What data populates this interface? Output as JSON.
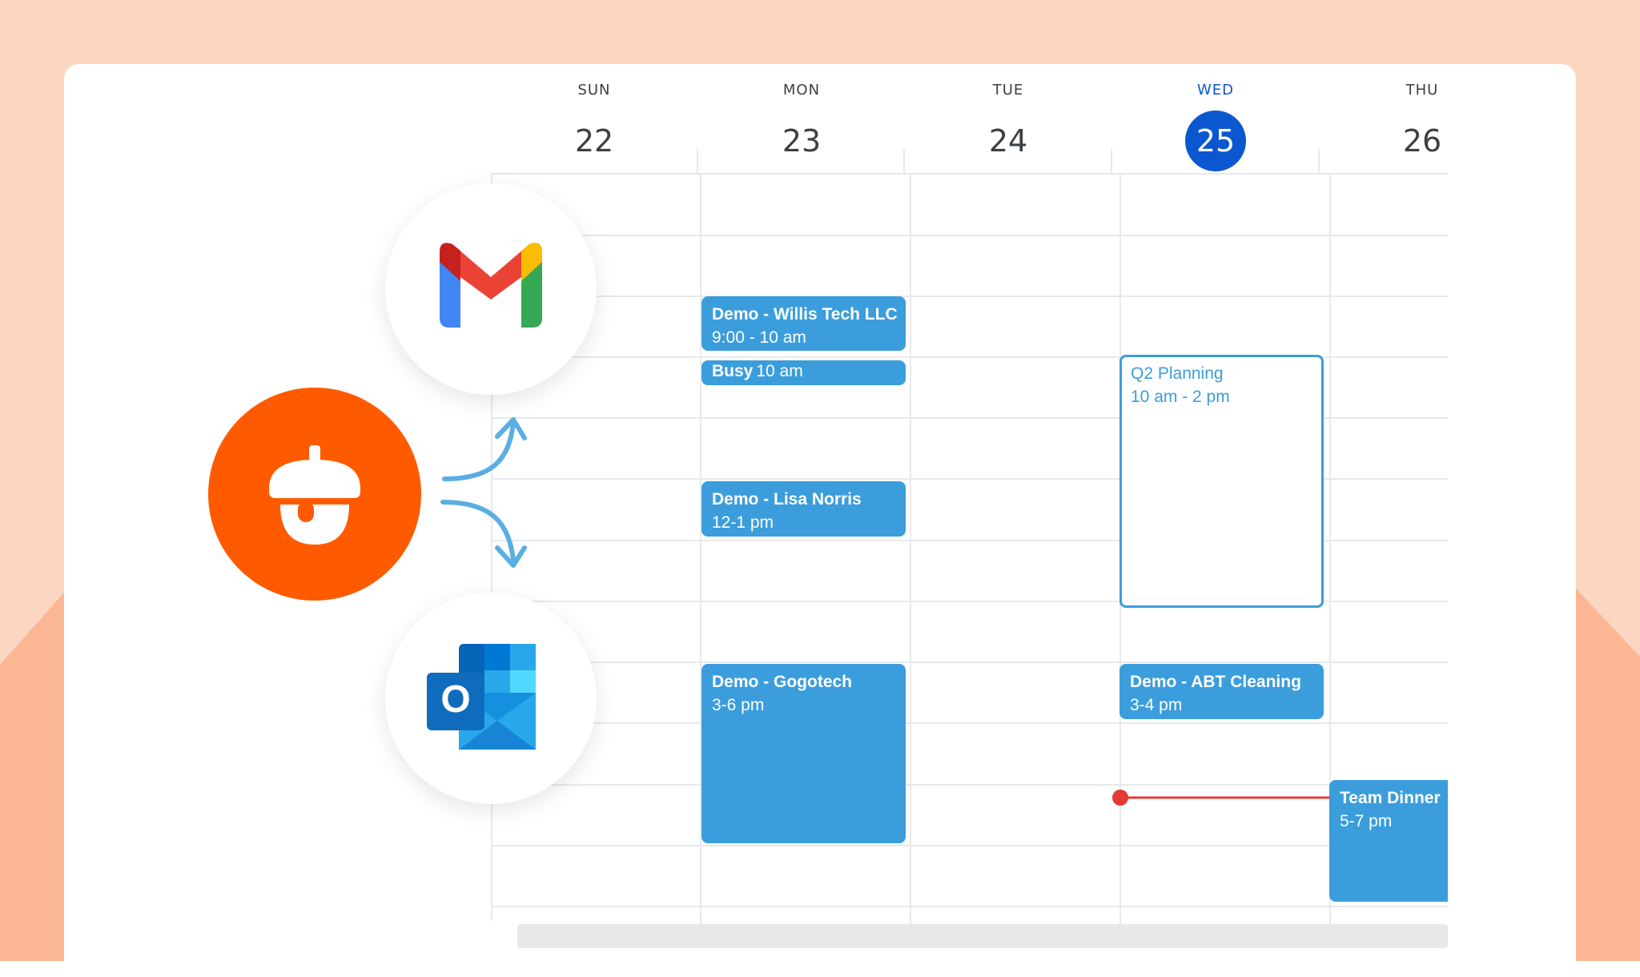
{
  "colors": {
    "background": "#fdd6c2",
    "background_shape": "#fbb694",
    "today_accent": "#0b57d0",
    "event_blue": "#3b9ddc",
    "now_line": "#e53935",
    "brand_orange": "#ff5a00"
  },
  "calendar": {
    "days": [
      {
        "name": "SUN",
        "date": "22"
      },
      {
        "name": "MON",
        "date": "23"
      },
      {
        "name": "TUE",
        "date": "24"
      },
      {
        "name": "WED",
        "date": "25",
        "today": true
      },
      {
        "name": "THU",
        "date": "26"
      }
    ],
    "events": [
      {
        "title": "Demo - Willis Tech LLC",
        "time": "9:00 - 10 am",
        "day": "MON"
      },
      {
        "title": "Busy",
        "time": "10 am",
        "day": "MON"
      },
      {
        "title": "Demo - Lisa Norris",
        "time": "12-1 pm",
        "day": "MON"
      },
      {
        "title": "Demo - Gogotech",
        "time": "3-6 pm",
        "day": "MON"
      },
      {
        "title": "Q2 Planning",
        "time": "10 am - 2 pm",
        "day": "WED"
      },
      {
        "title": "Demo - ABT Cleaning",
        "time": "3-4 pm",
        "day": "WED"
      },
      {
        "title": "Team Dinner",
        "time": "5-7 pm",
        "day": "THU"
      }
    ]
  },
  "integrations": {
    "source": "acorn-icon",
    "targets": [
      "gmail-icon",
      "outlook-icon"
    ],
    "outlook_letter": "O"
  }
}
